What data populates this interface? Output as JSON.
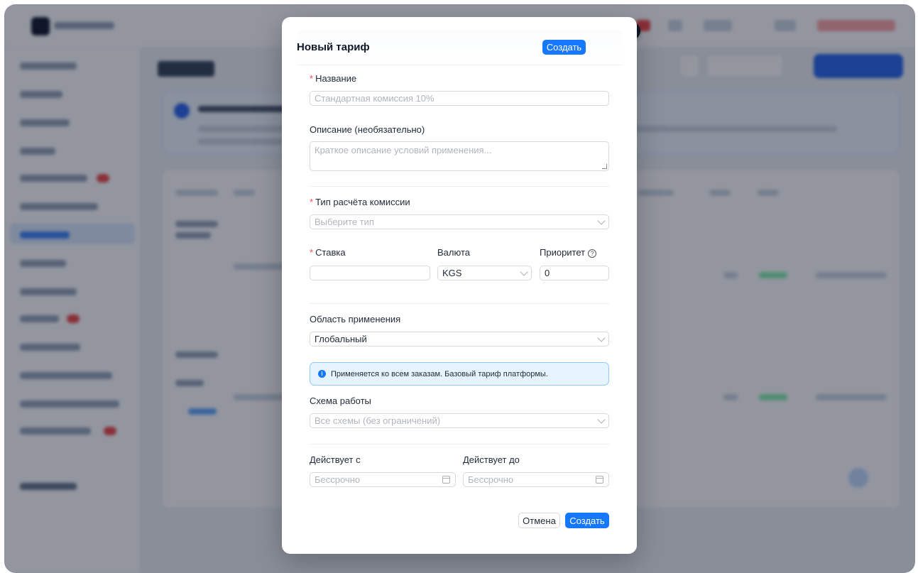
{
  "modal": {
    "title": "Новый тариф",
    "header_create_label": "Создать",
    "name": {
      "label": "Название",
      "placeholder": "Стандартная комиссия 10%"
    },
    "description": {
      "label": "Описание (необязательно)",
      "placeholder": "Краткое описание условий применения..."
    },
    "calc_type": {
      "label": "Тип расчёта комиссии",
      "placeholder": "Выберите тип"
    },
    "rate": {
      "label": "Ставка",
      "value": ""
    },
    "currency": {
      "label": "Валюта",
      "value": "KGS"
    },
    "priority": {
      "label": "Приоритет",
      "value": "0",
      "help_icon": "question-circle-icon"
    },
    "scope": {
      "label": "Область применения",
      "value": "Глобальный"
    },
    "info_text": "Применяется ко всем заказам. Базовый тариф платформы.",
    "scheme": {
      "label": "Схема работы",
      "placeholder": "Все схемы (без ограничений)"
    },
    "valid_from": {
      "label": "Действует с",
      "placeholder": "Бессрочно"
    },
    "valid_to": {
      "label": "Действует до",
      "placeholder": "Бессрочно"
    },
    "cancel_label": "Отмена",
    "footer_create_label": "Создать",
    "required_mark": "*"
  },
  "colors": {
    "primary": "#1677ff",
    "required": "#ff4d4f",
    "info_bg": "#e6f4ff",
    "info_border": "#91caff",
    "overlay": "rgba(15,23,42,0.45)"
  }
}
